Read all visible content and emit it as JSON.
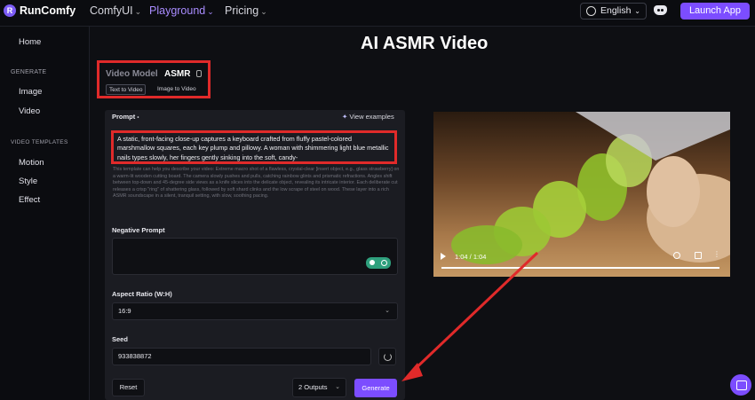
{
  "brand": {
    "name": "RunComfy",
    "logo_letter": "R"
  },
  "nav": [
    {
      "label": "ComfyUI",
      "active": false
    },
    {
      "label": "Playground",
      "active": true
    },
    {
      "label": "Pricing",
      "active": false
    }
  ],
  "language": "English",
  "launch_label": "Launch App",
  "sidebar": {
    "home": "Home",
    "generate_section": "GENERATE",
    "generate_items": [
      "Image",
      "Video"
    ],
    "templates_section": "VIDEO TEMPLATES",
    "template_items": [
      "Motion",
      "Style",
      "Effect"
    ]
  },
  "page_title": "AI ASMR Video",
  "model": {
    "label": "Video Model",
    "name": "ASMR",
    "tabs": [
      "Text to Video",
      "Image to Video"
    ],
    "active_tab": 0
  },
  "form": {
    "prompt_label": "Prompt",
    "required_mark": "•",
    "view_examples": "View examples",
    "prompt_value": "A static, front-facing close-up captures a keyboard crafted from fluffy pastel-colored marshmallow squares, each key plump and pillowy. A woman with shimmering light blue metallic nails types slowly, her fingers gently sinking into the soft, candy-",
    "prompt_help": "This template can help you describe your video: Extreme macro shot of a flawless, crystal-clear [insert object, e.g., glass strawberry] on a warm-lit wooden cutting board. The camera slowly pushes and pulls, catching rainbow glints and prismatic refractions. Angles shift between top-down and 45-degree side views as a knife slices into the delicate object, revealing its intricate interior. Each deliberate cut releases a crisp \"ring\" of shattering glass, followed by soft shard clinks and the low scrape of steel on wood. These layer into a rich ASMR soundscape in a silent, tranquil setting, with slow, soothing pacing.",
    "negative_label": "Negative Prompt",
    "negative_value": "",
    "aspect_label": "Aspect Ratio (W:H)",
    "aspect_value": "16:9",
    "seed_label": "Seed",
    "seed_value": "933838872",
    "reset_label": "Reset",
    "outputs_label": "2 Outputs",
    "generate_label": "Generate"
  },
  "video": {
    "time": "1:04 / 1:04",
    "progress": 1.0
  },
  "colors": {
    "accent": "#7c4dff",
    "highlight": "#e02a2a"
  }
}
